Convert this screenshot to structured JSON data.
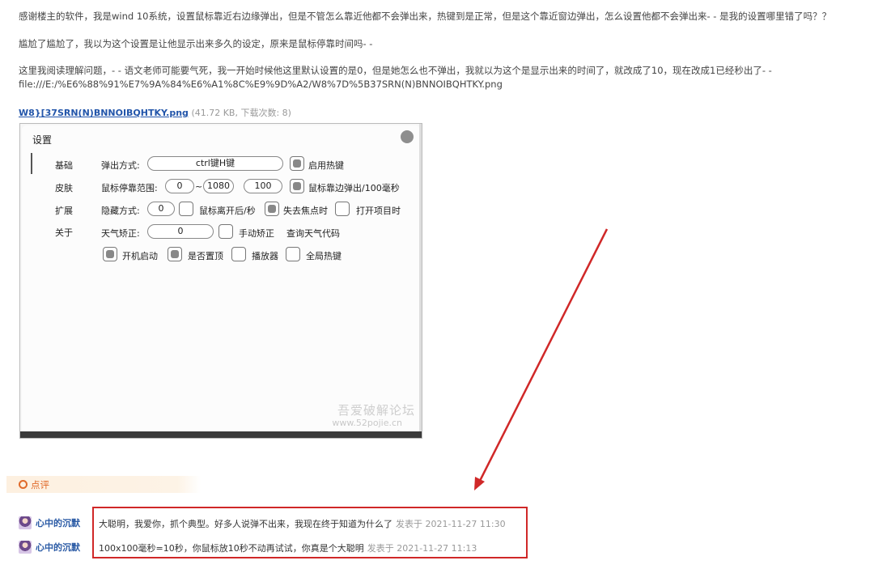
{
  "post": {
    "p1": "感谢楼主的软件，我是wind 10系统，设置鼠标靠近右边缘弹出，但是不管怎么靠近他都不会弹出来，热键到是正常，但是这个靠近窗边弹出，怎么设置他都不会弹出来- - 是我的设置哪里错了吗？？",
    "p2": "尴尬了尴尬了，我以为这个设置是让他显示出来多久的设定，原来是鼠标停靠时间吗- -",
    "p3": "这里我阅读理解问题，- - 语文老师可能要气死，我一开始时候他这里默认设置的是0，但是她怎么也不弹出，我就以为这个是显示出来的时间了，就改成了10，现在改成1已经秒出了- -",
    "p4": "file:///E:/%E6%88%91%E7%9A%84%E6%A1%8C%E9%9D%A2/W8%7D%5B37SRN(N)BNNOIBQHTKY.png"
  },
  "attachment": {
    "name": "W8}[37SRN(N)BNNOIBQHTKY.png",
    "meta": "(41.72 KB, 下载次数: 8)"
  },
  "settings_window": {
    "title": "设置",
    "nav": [
      "基础",
      "皮肤",
      "扩展",
      "关于"
    ],
    "popup_mode_label": "弹出方式:",
    "popup_mode_value": "ctrl键H键",
    "hotkey_enable": "启用热键",
    "mouse_range_label": "鼠标停靠范围:",
    "range_start": "0",
    "range_sep": "~",
    "range_end": "1080",
    "range_delay": "100",
    "edge_popup": "鼠标靠边弹出/100毫秒",
    "hide_mode_label": "隐藏方式:",
    "hide_mode_value": "0",
    "mouse_leave": "鼠标离开后/秒",
    "lose_focus": "失去焦点时",
    "open_project": "打开项目时",
    "weather_label": "天气矫正:",
    "weather_value": "0",
    "manual_correct": "手动矫正",
    "query_weather": "查询天气代码",
    "autostart": "开机启动",
    "pin_top": "是否置顶",
    "player": "播放器",
    "global_hotkey": "全局热键",
    "watermark_cn": "吾爱破解论坛",
    "watermark_url": "www.52pojie.cn"
  },
  "review": {
    "header": "点评",
    "comments": [
      {
        "user": "心中的沉默",
        "text": "大聪明，我爱你，抓个典型。好多人说弹不出来，我现在终于知道为什么了",
        "time": "发表于 2021-11-27 11:30"
      },
      {
        "user": "心中的沉默",
        "text": "100x100毫秒=10秒，你鼠标放10秒不动再试试，你真是个大聪明",
        "time": "发表于 2021-11-27 11:13"
      }
    ]
  },
  "colors": {
    "link": "#2255aa",
    "review_accent": "#e06a2a",
    "annotation_red": "#d02828"
  }
}
